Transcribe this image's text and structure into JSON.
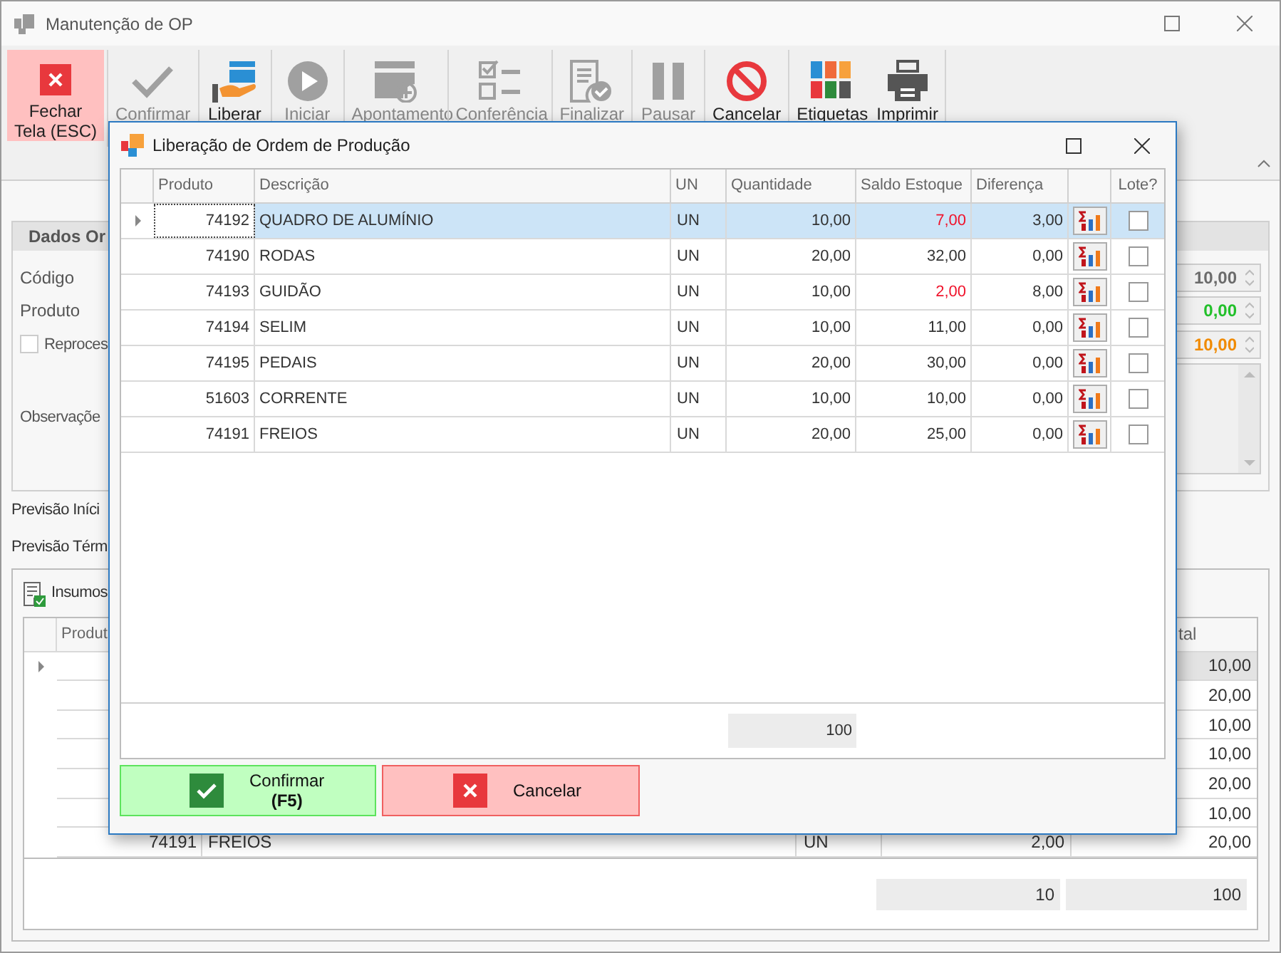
{
  "window": {
    "title": "Manutenção de OP"
  },
  "toolbar": [
    {
      "label": "Fechar Tela (ESC)",
      "kind": "close",
      "disabled": false,
      "active": true
    },
    {
      "label": "Confirmar",
      "kind": "check",
      "disabled": true,
      "active": false
    },
    {
      "label": "Liberar",
      "kind": "release",
      "disabled": false,
      "active": false
    },
    {
      "label": "Iniciar",
      "kind": "play",
      "disabled": true,
      "active": false
    },
    {
      "label": "Apontamento",
      "kind": "appointment",
      "disabled": true,
      "active": false
    },
    {
      "label": "Conferência",
      "kind": "checklist",
      "disabled": true,
      "active": false
    },
    {
      "label": "Finalizar",
      "kind": "report",
      "disabled": true,
      "active": false
    },
    {
      "label": "Pausar",
      "kind": "pause",
      "disabled": true,
      "active": false
    },
    {
      "label": "Cancelar",
      "kind": "cancel",
      "disabled": false,
      "active": false
    },
    {
      "label": "Etiquetas",
      "kind": "labels",
      "disabled": false,
      "active": false
    },
    {
      "label": "Imprimir",
      "kind": "print",
      "disabled": false,
      "active": false
    }
  ],
  "dados": {
    "title": "Dados Or",
    "fields": [
      {
        "label": "Código",
        "value": "10,00",
        "color": "#6b6b6b"
      },
      {
        "label": "Produto",
        "value": "0,00",
        "color": "#22c02a"
      },
      {
        "label": "Reproces",
        "kind": "checkbox",
        "checked": false,
        "value": "10,00",
        "color": "#f08a00"
      }
    ],
    "notes_label": "Observaçõe"
  },
  "previsao": [
    "Previsão Iníci",
    "Previsão Térm"
  ],
  "insumos": {
    "title": "Insumos",
    "columns": [
      {
        "label": "Produt"
      },
      {
        "label": "tal"
      }
    ],
    "rows": [
      {
        "total": "10,00",
        "selected": true
      },
      {
        "total": "20,00",
        "selected": false
      },
      {
        "total": "10,00",
        "selected": false
      },
      {
        "total": "10,00",
        "selected": false
      },
      {
        "total": "20,00",
        "selected": false
      },
      {
        "total": "10,00",
        "selected": false
      },
      {
        "produto": "74191",
        "descricao": "FREIOS",
        "un": "UN",
        "quantidade": "2,00",
        "total": "20,00",
        "selected": false
      }
    ],
    "footer": [
      "10",
      "100"
    ]
  },
  "dialog": {
    "title": "Liberação de Ordem de Produção",
    "columns": [
      "Produto",
      "Descrição",
      "UN",
      "Quantidade",
      "Saldo Estoque",
      "Diferença",
      "Lote?"
    ],
    "rows": [
      {
        "produto": "74192",
        "descricao": "QUADRO DE ALUMÍNIO",
        "un": "UN",
        "quantidade": "10,00",
        "saldo": "7,00",
        "diferenca": "3,00",
        "shortage": true,
        "lote": false,
        "selected": true
      },
      {
        "produto": "74190",
        "descricao": "RODAS",
        "un": "UN",
        "quantidade": "20,00",
        "saldo": "32,00",
        "diferenca": "0,00",
        "shortage": false,
        "lote": false,
        "selected": false
      },
      {
        "produto": "74193",
        "descricao": "GUIDÃO",
        "un": "UN",
        "quantidade": "10,00",
        "saldo": "2,00",
        "diferenca": "8,00",
        "shortage": true,
        "lote": false,
        "selected": false
      },
      {
        "produto": "74194",
        "descricao": "SELIM",
        "un": "UN",
        "quantidade": "10,00",
        "saldo": "11,00",
        "diferenca": "0,00",
        "shortage": false,
        "lote": false,
        "selected": false
      },
      {
        "produto": "74195",
        "descricao": "PEDAIS",
        "un": "UN",
        "quantidade": "20,00",
        "saldo": "30,00",
        "diferenca": "0,00",
        "shortage": false,
        "lote": false,
        "selected": false
      },
      {
        "produto": "51603",
        "descricao": "CORRENTE",
        "un": "UN",
        "quantidade": "10,00",
        "saldo": "10,00",
        "diferenca": "0,00",
        "shortage": false,
        "lote": false,
        "selected": false
      },
      {
        "produto": "74191",
        "descricao": "FREIOS",
        "un": "UN",
        "quantidade": "20,00",
        "saldo": "25,00",
        "diferenca": "0,00",
        "shortage": false,
        "lote": false,
        "selected": false
      }
    ],
    "total": "100",
    "confirm": {
      "label": "Confirmar",
      "shortcut": "(F5)"
    },
    "cancel": {
      "label": "Cancelar"
    }
  }
}
